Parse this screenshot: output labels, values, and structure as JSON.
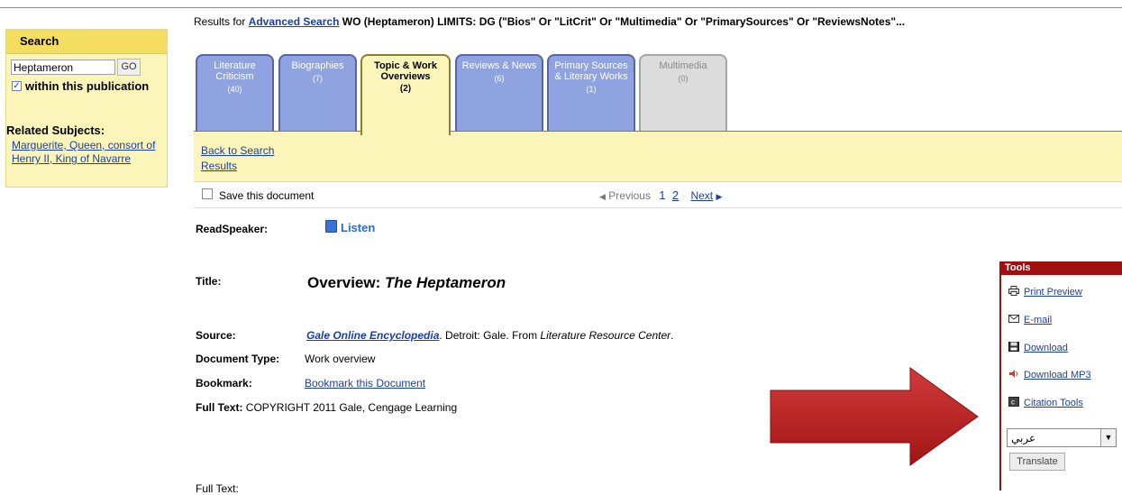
{
  "search": {
    "header": "Search",
    "input_value": "Heptameron",
    "go_label": "GO",
    "within_label": "within this publication",
    "within_checked": true,
    "related_title": "Related Subjects:",
    "related_link_1": "Marguerite, Queen, consort of",
    "related_link_2": "Henry II, King of Navarre"
  },
  "results": {
    "prefix": "Results for ",
    "link": "Advanced Search",
    "query": " WO (Heptameron) LIMITS: DG (\"Bios\" Or \"LitCrit\" Or \"Multimedia\" Or \"PrimarySources\" Or \"ReviewsNotes\"..."
  },
  "tabs": [
    {
      "label1": "Literature",
      "label2": "Criticism",
      "count": "(40)"
    },
    {
      "label1": "Biographies",
      "label2": "",
      "count": "(7)"
    },
    {
      "label1": "Topic & Work",
      "label2": "Overviews",
      "count": "(2)"
    },
    {
      "label1": "Reviews & News",
      "label2": "",
      "count": "(6)"
    },
    {
      "label1": "Primary Sources",
      "label2": "& Literary Works",
      "count": "(1)"
    },
    {
      "label1": "Multimedia",
      "label2": "",
      "count": "(0)"
    }
  ],
  "back_to_search": {
    "line1": "Back to Search",
    "line2": "Results"
  },
  "doc_bar": {
    "save_label": "Save this document",
    "previous_label": "Previous",
    "page1": "1",
    "page2": "2",
    "next_label": "Next"
  },
  "document": {
    "readspeaker_label": "ReadSpeaker:",
    "listen_label": "Listen",
    "title_label": "Title:",
    "title_prefix": "Overview: ",
    "title_work": "The Heptameron",
    "source_label": "Source:",
    "source_link": "Gale Online Encyclopedia",
    "source_mid": ". Detroit: Gale. From ",
    "source_italic": "Literature Resource Center",
    "source_end": ".",
    "doctype_label": "Document Type:",
    "doctype_value": "Work overview",
    "bookmark_label": "Bookmark:",
    "bookmark_link": "Bookmark this Document",
    "fulltext_label": "Full Text:",
    "fulltext_value": "COPYRIGHT 2011 Gale, Cengage Learning",
    "fulltext_label_2": "Full Text:"
  },
  "tools": {
    "header": "Tools",
    "print_preview": "Print Preview",
    "email": "E-mail",
    "download": "Download",
    "download_mp3": "Download MP3",
    "citation_tools": "Citation Tools",
    "language_value": "عربي",
    "translate_label": "Translate"
  },
  "colors": {
    "tab_blue": "#8ea3e0",
    "active_yellow": "#fbf5ba",
    "tools_red": "#a20d0d",
    "link_blue": "#1a3ea8",
    "arrow_red": "#c42a2a"
  }
}
